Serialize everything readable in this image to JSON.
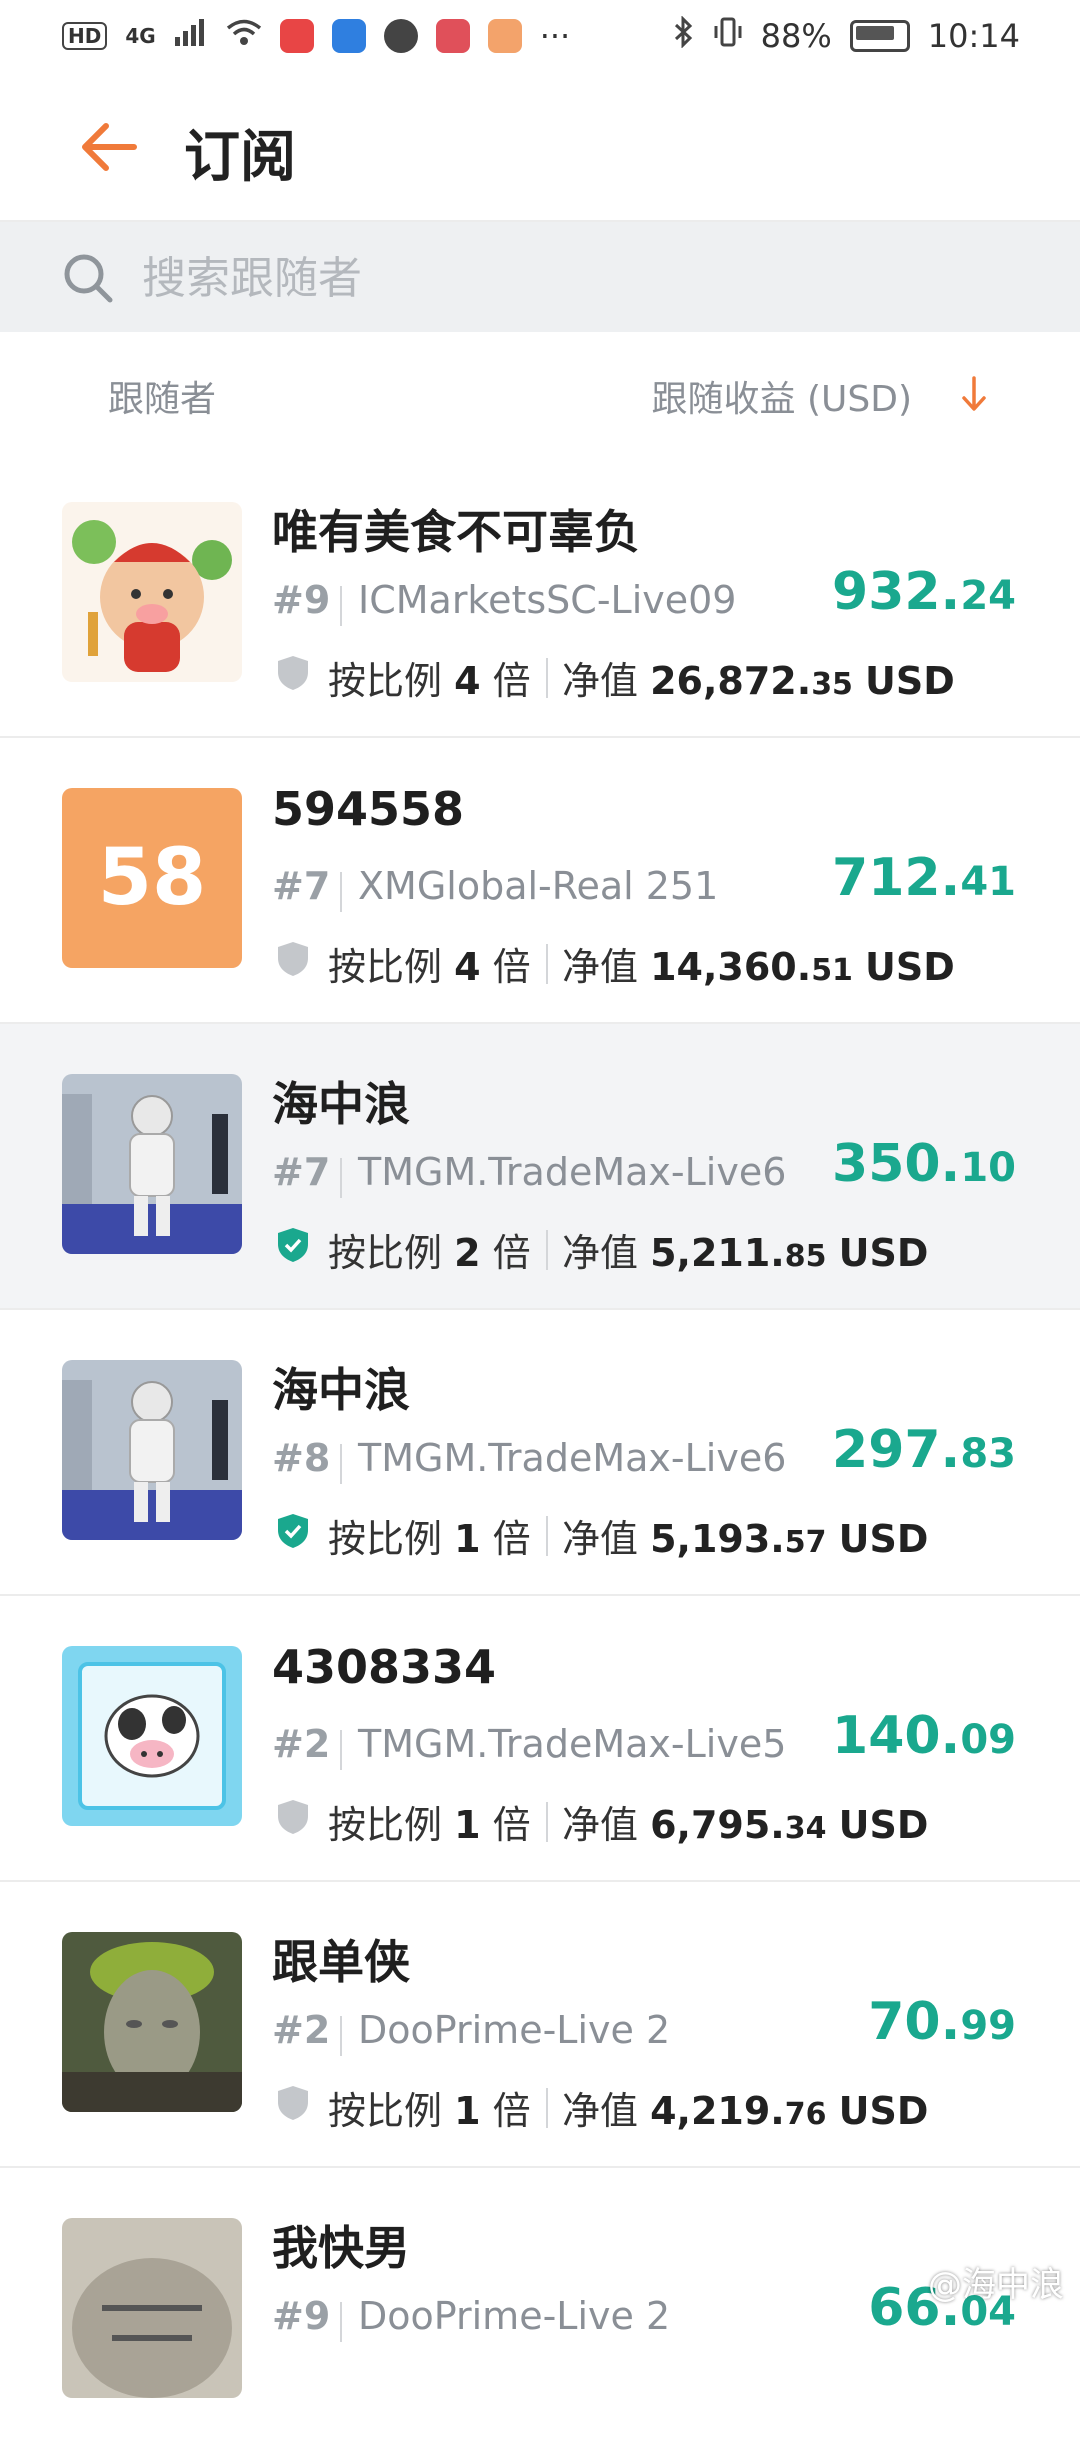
{
  "status_bar": {
    "hd": "HD",
    "net": "4G",
    "battery_pct": "88%",
    "time": "10:14",
    "more": "···"
  },
  "header": {
    "title": "订阅"
  },
  "search": {
    "placeholder": "搜索跟随者"
  },
  "columns": {
    "left": "跟随者",
    "right": "跟随收益 (USD)"
  },
  "labels": {
    "ratio_prefix": "按比例",
    "ratio_suffix": "倍",
    "nav_prefix": "净值",
    "currency": "USD"
  },
  "followers": [
    {
      "name": "唯有美食不可辜负",
      "rank": "#9",
      "server": "ICMarketsSC-Live09",
      "profit_int": "932.",
      "profit_dec": "24",
      "ratio": "4",
      "nav_int": "26,872.",
      "nav_dec": "35",
      "verified": false,
      "avatar": "cartoon-cow-new-year"
    },
    {
      "name": "594558",
      "rank": "#7",
      "server": "XMGlobal-Real 251",
      "profit_int": "712.",
      "profit_dec": "41",
      "ratio": "4",
      "nav_int": "14,360.",
      "nav_dec": "51",
      "verified": false,
      "avatar_text": "58"
    },
    {
      "name": "海中浪",
      "rank": "#7",
      "server": "TMGM.TradeMax-Live6",
      "profit_int": "350.",
      "profit_dec": "10",
      "ratio": "2",
      "nav_int": "5,211.",
      "nav_dec": "85",
      "verified": true,
      "avatar": "astronaut-photo"
    },
    {
      "name": "海中浪",
      "rank": "#8",
      "server": "TMGM.TradeMax-Live6",
      "profit_int": "297.",
      "profit_dec": "83",
      "ratio": "1",
      "nav_int": "5,193.",
      "nav_dec": "57",
      "verified": true,
      "avatar": "astronaut-photo"
    },
    {
      "name": "4308334",
      "rank": "#2",
      "server": "TMGM.TradeMax-Live5",
      "profit_int": "140.",
      "profit_dec": "09",
      "ratio": "1",
      "nav_int": "6,795.",
      "nav_dec": "34",
      "verified": false,
      "avatar": "cartoon-cow-screen"
    },
    {
      "name": "跟单侠",
      "rank": "#2",
      "server": "DooPrime-Live 2",
      "profit_int": "70.",
      "profit_dec": "99",
      "ratio": "1",
      "nav_int": "4,219.",
      "nav_dec": "76",
      "verified": false,
      "avatar": "stone-statue-photo"
    },
    {
      "name": "我快男",
      "rank": "#9",
      "server": "DooPrime-Live 2",
      "profit_int": "66.",
      "profit_dec": "04",
      "ratio": "",
      "nav_int": "",
      "nav_dec": "",
      "verified": false,
      "avatar": "stone-photo"
    }
  ],
  "watermark": "@海中浪",
  "colors": {
    "accent": "#f07a3a",
    "profit": "#1aa88e",
    "shield_verified": "#1aa88e",
    "shield_default": "#c4c7cb"
  }
}
